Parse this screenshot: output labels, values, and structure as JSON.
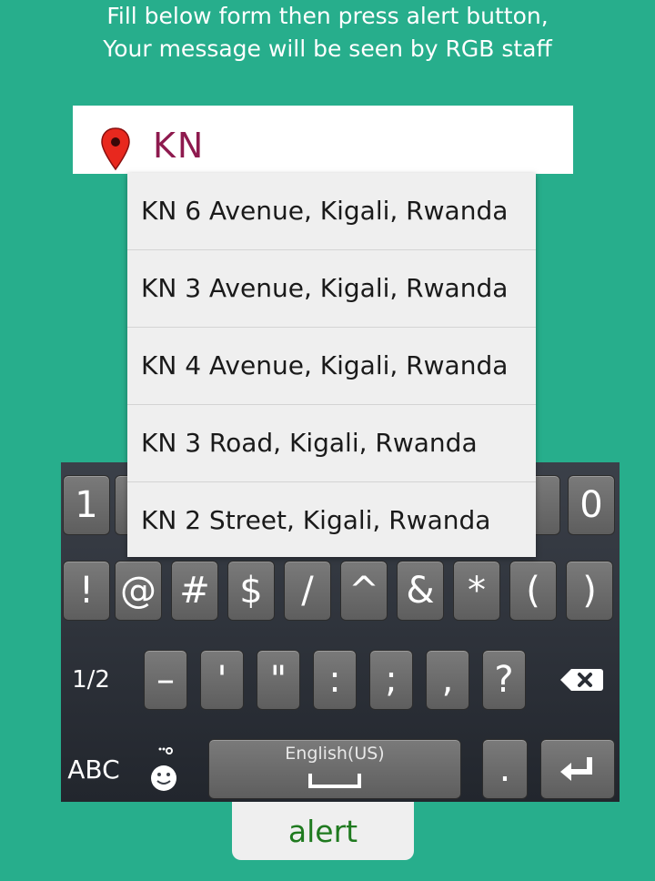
{
  "instructions": {
    "line1": "Fill below form then press alert button,",
    "line2": "Your message will be seen by RGB staff"
  },
  "search": {
    "value": "KN",
    "icon": "map-pin-icon"
  },
  "suggestions": [
    "KN 6 Avenue, Kigali, Rwanda",
    "KN 3 Avenue, Kigali, Rwanda",
    "KN 4 Avenue, Kigali, Rwanda",
    "KN 3 Road, Kigali, Rwanda",
    "KN 2 Street, Kigali, Rwanda"
  ],
  "keyboard": {
    "row1_visible": [
      "1",
      "0"
    ],
    "row2": [
      "!",
      "@",
      "#",
      "$",
      "/",
      "^",
      "&",
      "*",
      "(",
      ")"
    ],
    "row3": [
      "1/2",
      "–",
      "'",
      "\"",
      ":",
      ";",
      ",",
      "?"
    ],
    "row3_icons": [
      "backspace-icon"
    ],
    "row4": {
      "abc": "ABC",
      "language": "English(US)",
      "period": ".",
      "icons": [
        "emoji-settings-icon",
        "space-bar-icon",
        "enter-icon"
      ]
    }
  },
  "alert_button": {
    "label": "alert"
  },
  "colors": {
    "background": "#27ae8c",
    "input_text": "#8e1a4e",
    "alert_text": "#1f7a1f",
    "pin": "#e8281e"
  }
}
